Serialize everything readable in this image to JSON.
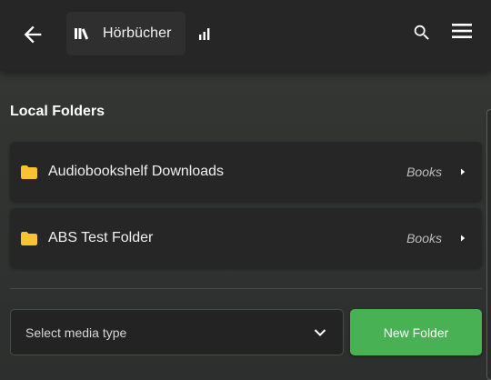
{
  "header": {
    "back_icon": "arrow-left-icon",
    "library": {
      "icon": "library-books-icon",
      "name": "Hörbücher"
    },
    "stats_icon": "bar-chart-icon",
    "search_icon": "search-icon",
    "menu_icon": "hamburger-menu-icon"
  },
  "section": {
    "title": "Local Folders"
  },
  "folders": [
    {
      "icon": "folder-icon",
      "name": "Audiobookshelf Downloads",
      "type": "Books",
      "chevron": "chevron-right-icon"
    },
    {
      "icon": "folder-icon",
      "name": "ABS Test Folder",
      "type": "Books",
      "chevron": "chevron-right-icon"
    }
  ],
  "form": {
    "select_placeholder": "Select media type",
    "select_icon": "chevron-down-icon",
    "new_folder_label": "New Folder"
  },
  "colors": {
    "topbar": "#262626",
    "card": "#262626",
    "folder_icon": "#f7c331",
    "primary_button": "#48b153"
  }
}
